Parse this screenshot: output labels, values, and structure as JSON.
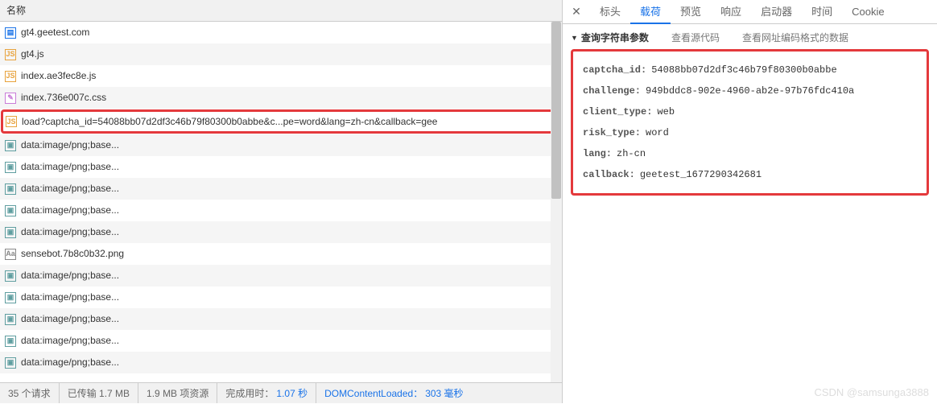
{
  "left": {
    "header": "名称",
    "rows": [
      {
        "icon": "doc",
        "text": "gt4.geetest.com"
      },
      {
        "icon": "js",
        "text": "gt4.js"
      },
      {
        "icon": "js",
        "text": "index.ae3fec8e.js"
      },
      {
        "icon": "css",
        "text": "index.736e007c.css"
      },
      {
        "icon": "js",
        "text": "load?captcha_id=54088bb07d2df3c46b79f80300b0abbe&c...pe=word&lang=zh-cn&callback=gee",
        "selected": true
      },
      {
        "icon": "img",
        "text": "data:image/png;base..."
      },
      {
        "icon": "img",
        "text": "data:image/png;base..."
      },
      {
        "icon": "img",
        "text": "data:image/png;base..."
      },
      {
        "icon": "img",
        "text": "data:image/png;base..."
      },
      {
        "icon": "img",
        "text": "data:image/png;base..."
      },
      {
        "icon": "font",
        "text": "sensebot.7b8c0b32.png"
      },
      {
        "icon": "img",
        "text": "data:image/png;base..."
      },
      {
        "icon": "img",
        "text": "data:image/png;base..."
      },
      {
        "icon": "img",
        "text": "data:image/png;base..."
      },
      {
        "icon": "img",
        "text": "data:image/png;base..."
      },
      {
        "icon": "img",
        "text": "data:image/png;base..."
      }
    ],
    "status": {
      "requests": "35 个请求",
      "transferred": "已传输 1.7 MB",
      "resources": "1.9 MB 项资源",
      "finish_label": "完成用时：",
      "finish_value": "1.07 秒",
      "dcl_label": "DOMContentLoaded：",
      "dcl_value": "303 毫秒"
    }
  },
  "right": {
    "tabs": [
      "标头",
      "载荷",
      "预览",
      "响应",
      "启动器",
      "时间",
      "Cookie"
    ],
    "active_tab_index": 1,
    "section_title": "查询字符串参数",
    "view_source": "查看源代码",
    "view_encoded": "查看网址编码格式的数据",
    "params": [
      {
        "k": "captcha_id:",
        "v": "54088bb07d2df3c46b79f80300b0abbe"
      },
      {
        "k": "challenge:",
        "v": "949bddc8-902e-4960-ab2e-97b76fdc410a"
      },
      {
        "k": "client_type:",
        "v": "web"
      },
      {
        "k": "risk_type:",
        "v": "word"
      },
      {
        "k": "lang:",
        "v": "zh-cn"
      },
      {
        "k": "callback:",
        "v": "geetest_1677290342681"
      }
    ]
  },
  "watermark": "CSDN @samsunga3888"
}
